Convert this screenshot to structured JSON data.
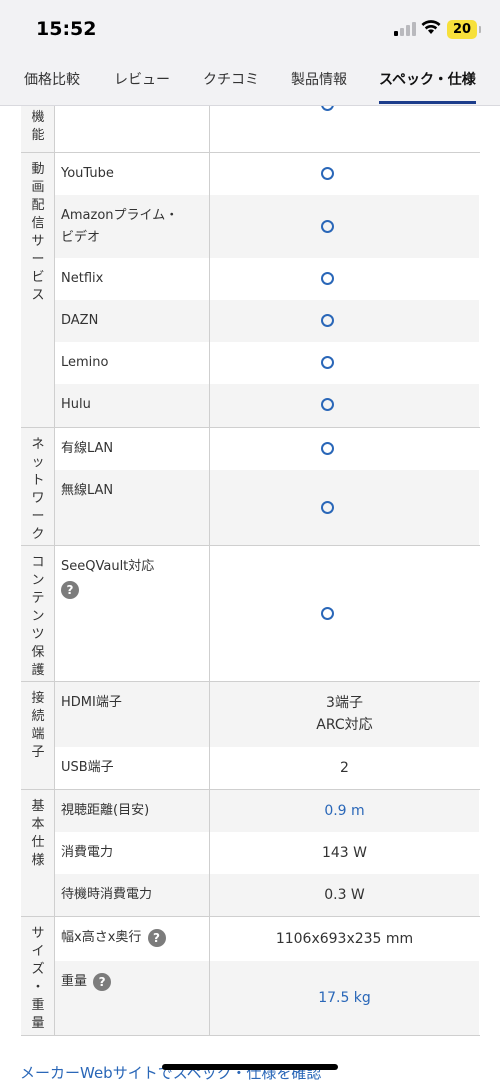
{
  "status": {
    "time": "15:52",
    "battery": "20"
  },
  "tabs": [
    "価格比較",
    "レビュー",
    "クチコミ",
    "製品情報",
    "スペック・仕様"
  ],
  "active_tab": 4,
  "groups": {
    "function": {
      "category": [
        "機",
        "能"
      ]
    },
    "streaming": {
      "category": [
        "動",
        "画",
        "配",
        "信",
        "サ",
        "ー",
        "ビ",
        "ス"
      ],
      "rows": [
        "YouTube",
        "Amazonプライム・ビデオ",
        "Netflix",
        "DAZN",
        "Lemino",
        "Hulu"
      ]
    },
    "network": {
      "category": [
        "ネ",
        "ッ",
        "ト",
        "ワ",
        "ー",
        "ク"
      ],
      "rows": [
        "有線LAN",
        "無線LAN"
      ]
    },
    "protection": {
      "category": [
        "コ",
        "ン",
        "テ",
        "ン",
        "ツ",
        "保",
        "護"
      ],
      "rows": [
        "SeeQVault対応"
      ]
    },
    "ports": {
      "category": [
        "接",
        "続",
        "端",
        "子"
      ],
      "rows": [
        {
          "label": "HDMI端子",
          "value_line1": "3端子",
          "value_line2": "ARC対応"
        },
        {
          "label": "USB端子",
          "value": "2"
        }
      ]
    },
    "basic": {
      "category": [
        "基",
        "本",
        "仕",
        "様"
      ],
      "rows": [
        {
          "label": "視聴距離(目安)",
          "value": "0.9 m"
        },
        {
          "label": "消費電力",
          "value": "143 W"
        },
        {
          "label": "待機時消費電力",
          "value": "0.3 W"
        }
      ]
    },
    "size": {
      "category": [
        "サ",
        "イ",
        "ズ",
        "・",
        "重",
        "量"
      ],
      "rows": [
        {
          "label": "幅x高さx奥行",
          "value": "1106x693x235 mm"
        },
        {
          "label": "重量",
          "value": "17.5 kg"
        }
      ]
    }
  },
  "help_glyph": "?",
  "footer_link": "メーカーWebサイトでスペック・仕様を確認"
}
